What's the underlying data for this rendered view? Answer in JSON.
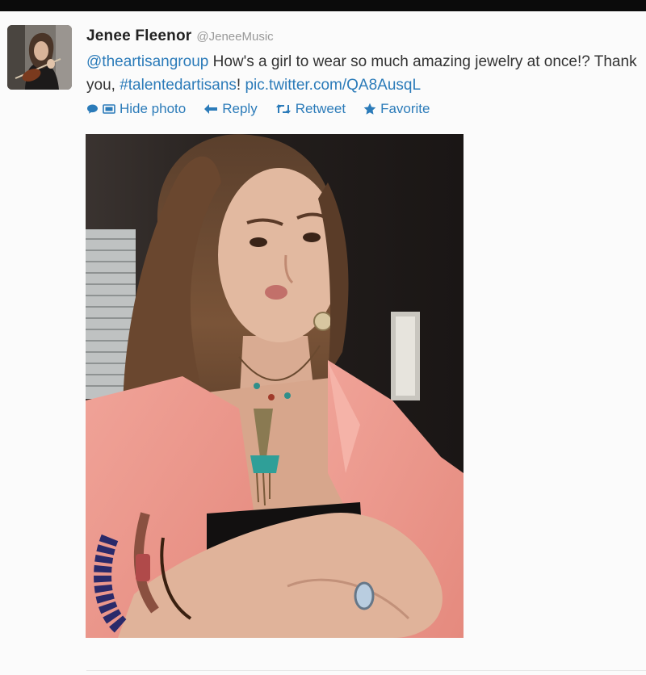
{
  "tweet": {
    "author_name": "Jenee Fleenor",
    "author_handle": "@JeneeMusic",
    "text": {
      "mention": "@theartisangroup",
      "body_1": " How's a girl to wear so much amazing jewelry at once!? Thank you, ",
      "hashtag": "#talentedartisans",
      "body_2": "! ",
      "link": "pic.twitter.com/QA8AusqL"
    },
    "actions": {
      "hide_photo": "Hide photo",
      "reply": "Reply",
      "retweet": "Retweet",
      "favorite": "Favorite"
    }
  },
  "icons": [
    "speech-bubble-icon",
    "photo-icon",
    "reply-icon",
    "retweet-icon",
    "star-icon"
  ],
  "colors": {
    "link": "#2b7bb9",
    "text": "#333333",
    "handle": "#999999",
    "top_bar": "#0b0b0b",
    "background": "#fbfbfb"
  }
}
